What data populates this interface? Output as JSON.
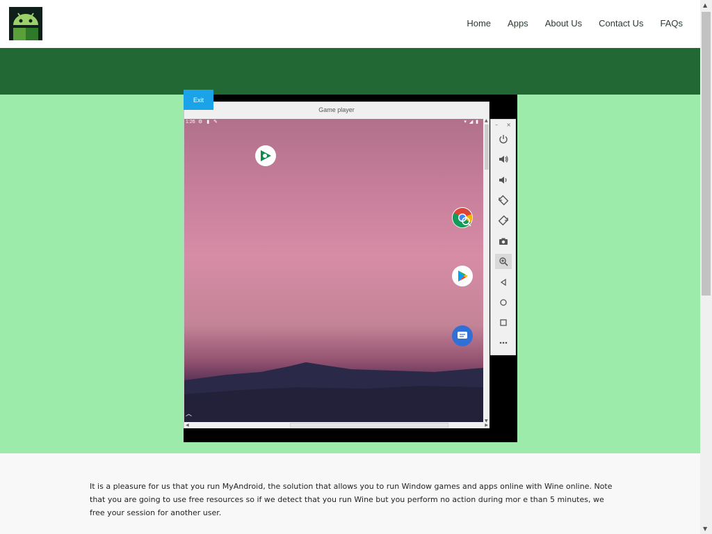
{
  "nav": {
    "items": [
      "Home",
      "Apps",
      "About Us",
      "Contact Us",
      "FAQs"
    ]
  },
  "emulator": {
    "exit_label": "Exit",
    "window_title": "Game player",
    "status_time": "1:26",
    "apps": [
      "google-play-games-icon",
      "chrome-icon",
      "play-store-icon",
      "messages-icon"
    ],
    "toolbar": [
      "power-icon",
      "volume-up-icon",
      "volume-down-icon",
      "rotate-left-icon",
      "rotate-right-icon",
      "camera-icon",
      "zoom-icon",
      "back-icon",
      "home-icon",
      "overview-icon",
      "more-icon"
    ]
  },
  "info": {
    "text": "It is a pleasure for us that you run MyAndroid, the solution that allows you to run Window games and apps online with Wine online. Note that you are going to use free resources so if we detect that you run Wine but you perform no action during mor e than 5 minutes, we free your session for another user."
  },
  "colors": {
    "header_band": "#226835",
    "light_band": "#9cebab",
    "exit_button": "#1aa3e8"
  }
}
